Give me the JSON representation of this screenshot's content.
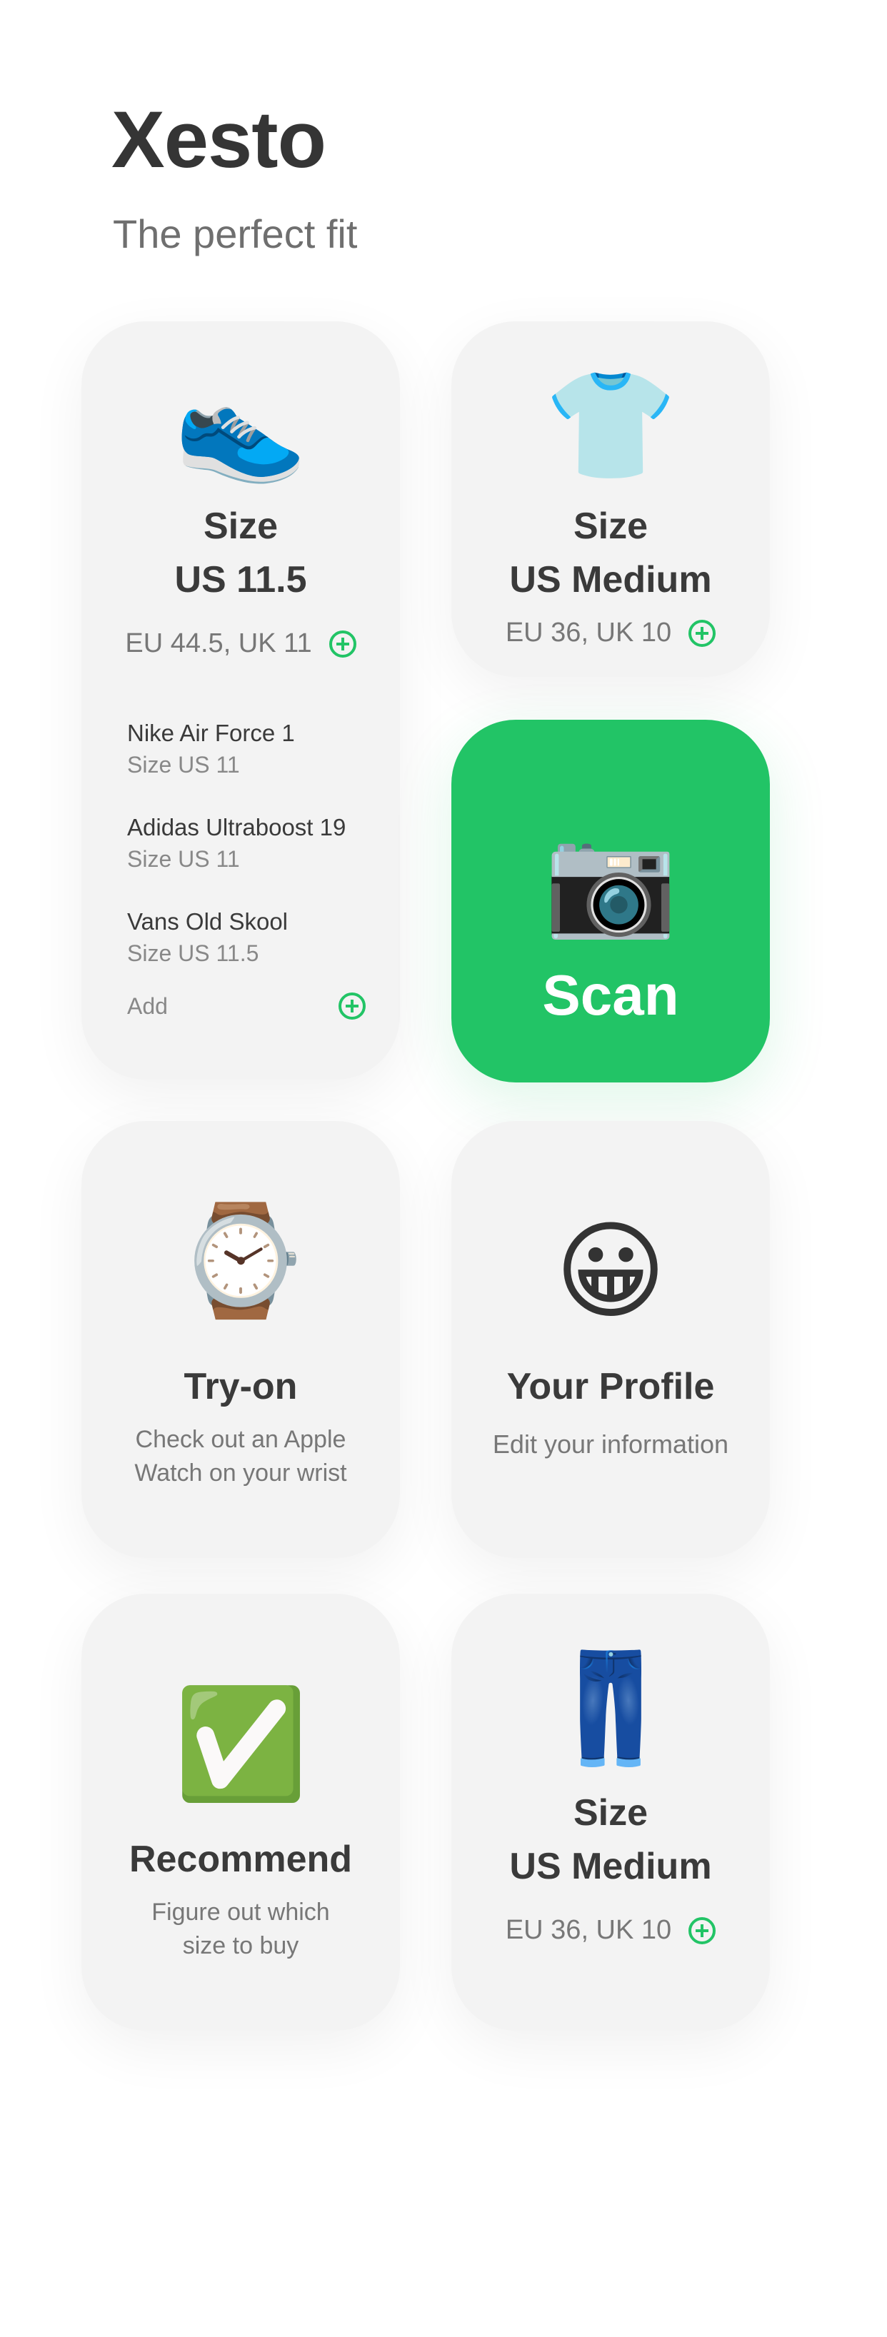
{
  "header": {
    "title": "Xesto",
    "subtitle": "The perfect fit"
  },
  "accent_color": "#22c466",
  "cards": {
    "shoes": {
      "icon": "sneaker-icon",
      "emoji": "👟",
      "label": "Size",
      "size": "US 11.5",
      "conversion": "EU 44.5, UK 11",
      "items": [
        {
          "name": "Nike Air Force 1",
          "size": "Size US 11"
        },
        {
          "name": "Adidas Ultraboost 19",
          "size": "Size US 11"
        },
        {
          "name": "Vans Old Skool",
          "size": "Size US 11.5"
        }
      ],
      "add_label": "Add"
    },
    "shirt": {
      "icon": "polo-shirt-icon",
      "emoji": "👕",
      "label": "Size",
      "size": "US Medium",
      "conversion": "EU 36, UK 10"
    },
    "scan": {
      "icon": "camera-icon",
      "emoji": "📷",
      "label": "Scan"
    },
    "tryon": {
      "icon": "watch-icon",
      "emoji": "⌚",
      "title": "Try-on",
      "line1": "Check out an Apple",
      "line2": "Watch on your wrist"
    },
    "profile": {
      "icon": "smiley-face-icon",
      "emoji": "😀",
      "title": "Your Profile",
      "line1": "Edit your information"
    },
    "recommend": {
      "icon": "check-mark-icon",
      "emoji": "✅",
      "title": "Recommend",
      "line1": "Figure out which",
      "line2": "size to buy"
    },
    "jeans": {
      "icon": "jeans-icon",
      "emoji": "👖",
      "label": "Size",
      "size": "US Medium",
      "conversion": "EU 36, UK 10"
    }
  }
}
